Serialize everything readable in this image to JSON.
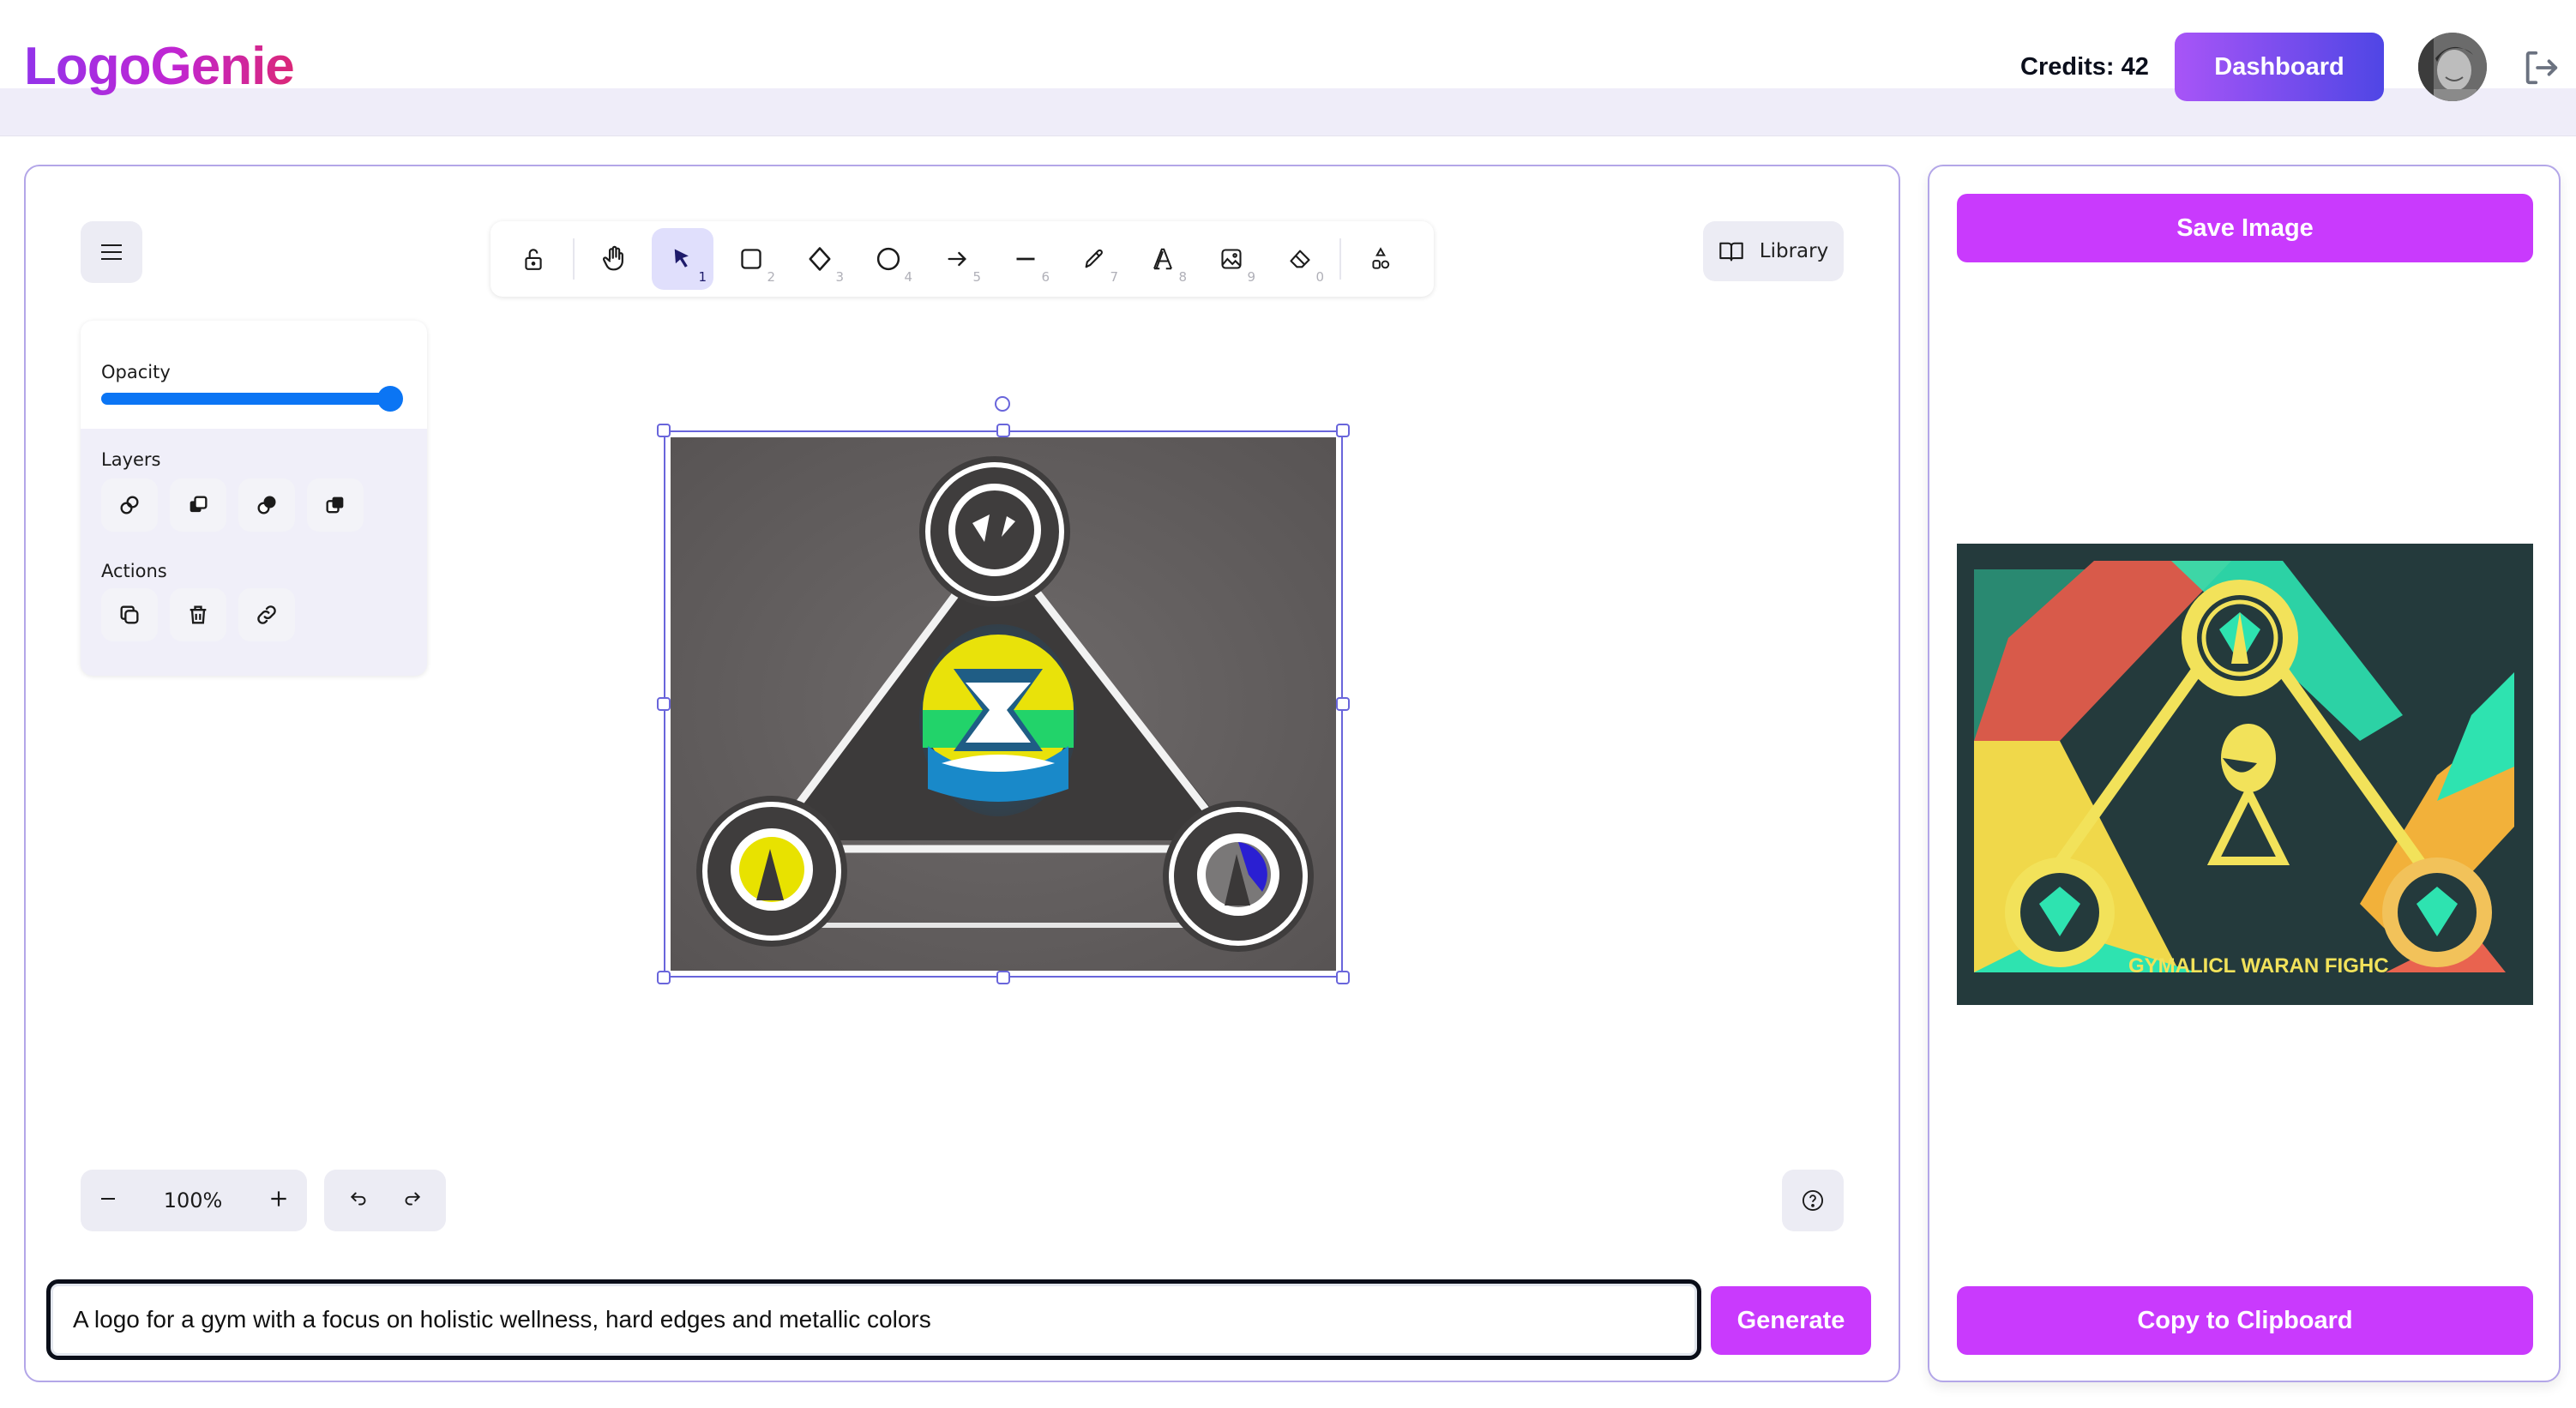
{
  "app": {
    "title": "LogoGenie",
    "credits_label": "Credits: 42",
    "dashboard_label": "Dashboard",
    "avatar_alt": "User avatar",
    "logout_icon": "logout-icon"
  },
  "colors": {
    "brand_gradient_start": "#9333ea",
    "brand_gradient_end": "#db2777",
    "dashboard_gradient_start": "#a855f7",
    "dashboard_gradient_end": "#4f46e5",
    "primary_button": "#c93afd",
    "panel_border": "#b3a6e8",
    "selection": "#6965db",
    "slider": "#0b75f4"
  },
  "toolbar": {
    "tools": [
      {
        "name": "lock",
        "icon": "unlock-icon",
        "key": ""
      },
      {
        "name": "hand",
        "icon": "hand-icon",
        "key": ""
      },
      {
        "name": "selection",
        "icon": "pointer-icon",
        "key": "1",
        "active": true
      },
      {
        "name": "rectangle",
        "icon": "rectangle-icon",
        "key": "2"
      },
      {
        "name": "diamond",
        "icon": "diamond-icon",
        "key": "3"
      },
      {
        "name": "ellipse",
        "icon": "ellipse-icon",
        "key": "4"
      },
      {
        "name": "arrow",
        "icon": "arrow-icon",
        "key": "5"
      },
      {
        "name": "line",
        "icon": "line-icon",
        "key": "6"
      },
      {
        "name": "draw",
        "icon": "pencil-icon",
        "key": "7"
      },
      {
        "name": "text",
        "icon": "text-icon",
        "key": "8"
      },
      {
        "name": "image",
        "icon": "image-icon",
        "key": "9"
      },
      {
        "name": "eraser",
        "icon": "eraser-icon",
        "key": "0"
      },
      {
        "name": "extra-tools",
        "icon": "shapes-icon",
        "key": ""
      }
    ]
  },
  "library": {
    "label": "Library"
  },
  "properties": {
    "opacity_label": "Opacity",
    "opacity_value": 100,
    "layers_label": "Layers",
    "layers_buttons": [
      "send-to-back",
      "send-backward",
      "bring-forward",
      "bring-to-front"
    ],
    "actions_label": "Actions",
    "actions_buttons": [
      "duplicate",
      "delete",
      "link"
    ]
  },
  "zoom": {
    "level": "100%",
    "minus": "zoom-out",
    "plus": "zoom-in"
  },
  "history": {
    "undo": "undo",
    "redo": "redo"
  },
  "help": {
    "icon": "help-icon"
  },
  "prompt": {
    "value": "A logo for a gym with a focus on holistic wellness, hard edges and metallic colors",
    "placeholder": ""
  },
  "buttons": {
    "generate": "Generate",
    "save_image": "Save Image",
    "copy_to_clipboard": "Copy to Clipboard"
  },
  "canvas_image": {
    "description": "Generated logo: triangle with three circular badges and central hourglass emblem",
    "selected": true
  },
  "preview_image": {
    "description": "Stylized logo preview with yellow triangle, teal and orange shapes",
    "caption_text": "GYMALICL WARAN FIGHC"
  }
}
